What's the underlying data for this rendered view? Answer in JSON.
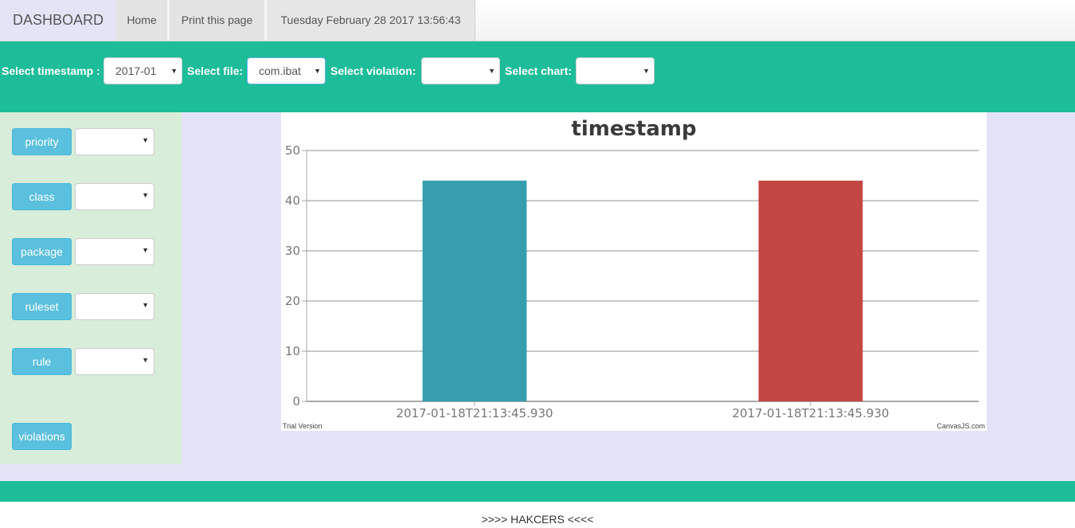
{
  "nav": {
    "brand": "DASHBOARD",
    "home": "Home",
    "print": "Print this page",
    "datetime": "Tuesday February 28 2017 13:56:43"
  },
  "filters": {
    "timestamp_label": "Select timestamp :",
    "timestamp_value": "2017-01",
    "file_label": "Select file:",
    "file_value": "com.ibat",
    "violation_label": "Select violation:",
    "violation_value": "",
    "chart_label": "Select chart:",
    "chart_value": ""
  },
  "sidebar": {
    "items": [
      {
        "label": "priority",
        "value": ""
      },
      {
        "label": "class",
        "value": ""
      },
      {
        "label": "package",
        "value": ""
      },
      {
        "label": "ruleset",
        "value": ""
      },
      {
        "label": "rule",
        "value": ""
      }
    ],
    "violations_button": "violations"
  },
  "chart_data": {
    "type": "bar",
    "title": "timestamp",
    "categories": [
      "2017-01-18T21:13:45.930",
      "2017-01-18T21:13:45.930"
    ],
    "values": [
      44,
      44
    ],
    "colors": [
      "#369ead",
      "#c24642"
    ],
    "ylim": [
      0,
      50
    ],
    "yticks": [
      0,
      10,
      20,
      30,
      40,
      50
    ],
    "grid": true,
    "watermark_left": "Trial Version",
    "watermark_right": "CanvasJS.com"
  },
  "footer": {
    "text": ">>>> HAKCERS <<<<"
  }
}
